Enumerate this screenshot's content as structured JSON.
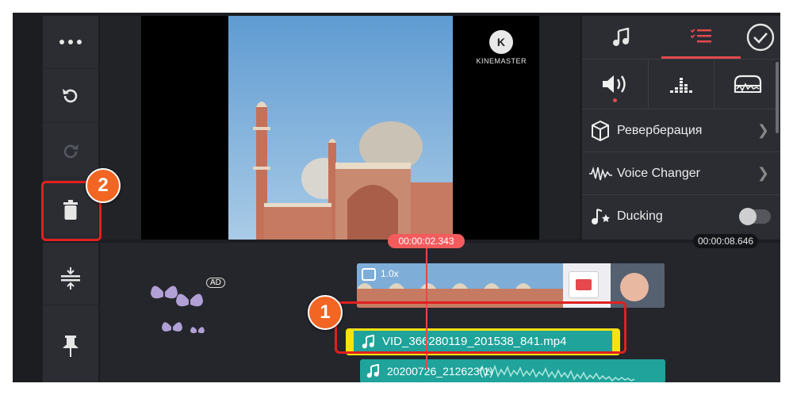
{
  "left_toolbar": {
    "more_label": "more",
    "undo_label": "undo",
    "redo_label": "redo",
    "delete_label": "delete",
    "split_label": "split",
    "pin_label": "pin"
  },
  "preview": {
    "watermark": "KINEMASTER",
    "logo_letter": "K"
  },
  "right_panel": {
    "tabs": [
      "music-tab",
      "list-tab"
    ],
    "items": [
      {
        "label": "Реверберация"
      },
      {
        "label": "Voice Changer"
      },
      {
        "label": "Ducking"
      }
    ],
    "ducking_on": false
  },
  "timeline": {
    "current_time": "00:00:02.343",
    "end_time": "00:00:08.646",
    "video_speed": "1.0x",
    "ad_badge": "AD",
    "audio_clip_name": "VID_366280119_201538_841.mp4",
    "audio_clip2_name": "20200726_212623(1)"
  },
  "annotations": {
    "step1": "1",
    "step2": "2"
  },
  "colors": {
    "accent": "#e5484d",
    "audio_clip": "#1fa39a",
    "selection": "#f5e210",
    "annotation": "#e02020",
    "badge": "#f26522"
  }
}
